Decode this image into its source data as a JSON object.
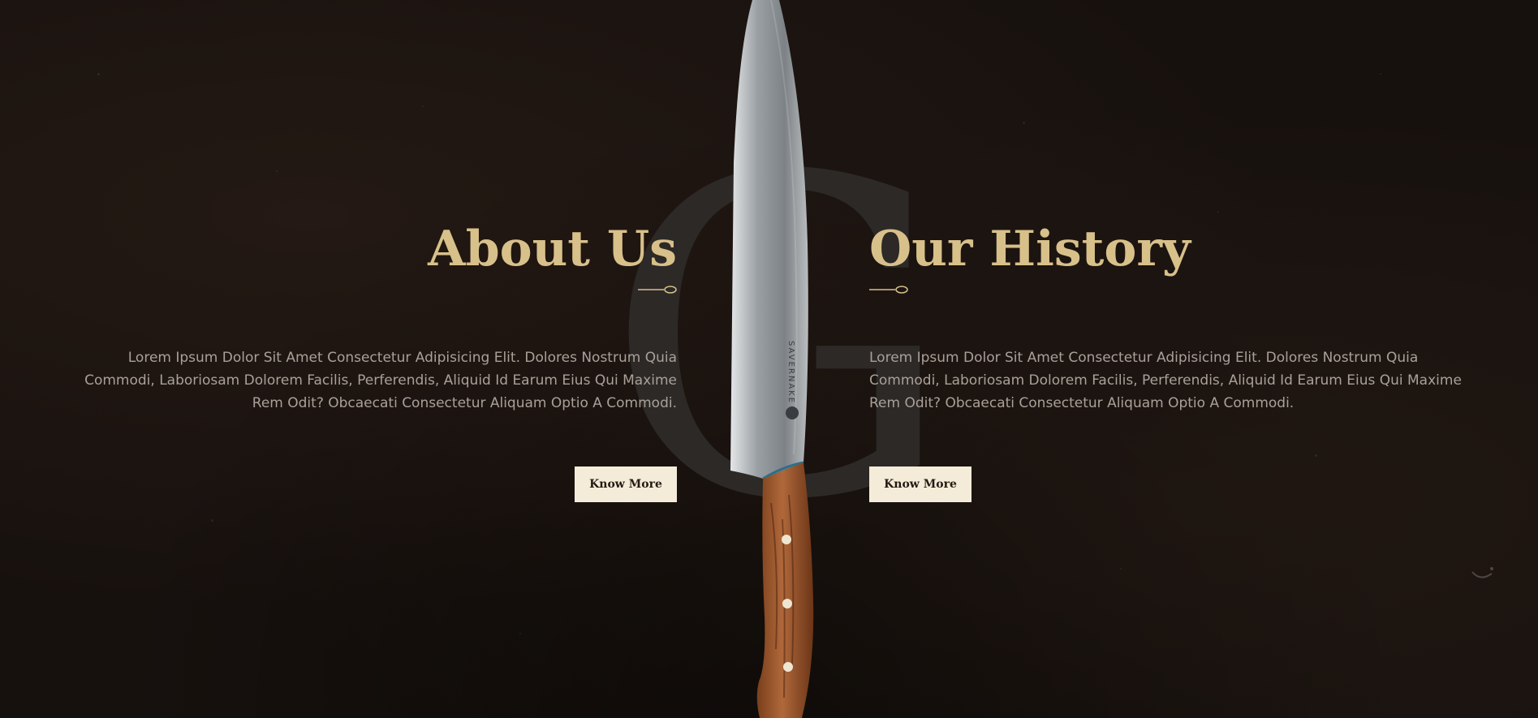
{
  "about": {
    "title": "About Us",
    "text": "Lorem Ipsum Dolor Sit Amet Consectetur Adipisicing Elit. Dolores Nostrum Quia Commodi, Laboriosam Dolorem Facilis, Perferendis, Aliquid Id Earum Eius Qui Maxime Rem Odit? Obcaecati Consectetur Aliquam Optio A Commodi.",
    "button": "Know More"
  },
  "history": {
    "title": "Our History",
    "text": "Lorem Ipsum Dolor Sit Amet Consectetur Adipisicing Elit. Dolores Nostrum Quia Commodi, Laboriosam Dolorem Facilis, Perferendis, Aliquid Id Earum Eius Qui Maxime Rem Odit? Obcaecati Consectetur Aliquam Optio A Commodi.",
    "button": "Know More"
  },
  "background_letter": "G",
  "knife": {
    "brand": "SAVERNAKE"
  },
  "icons": {
    "divider": "spoon-divider-icon",
    "knife": "knife-image",
    "corner": "crescent-icon"
  },
  "colors": {
    "accent": "#d8c08a",
    "button_bg": "#f4ecd9",
    "background": "#17110e",
    "body_text": "#a9a098"
  }
}
